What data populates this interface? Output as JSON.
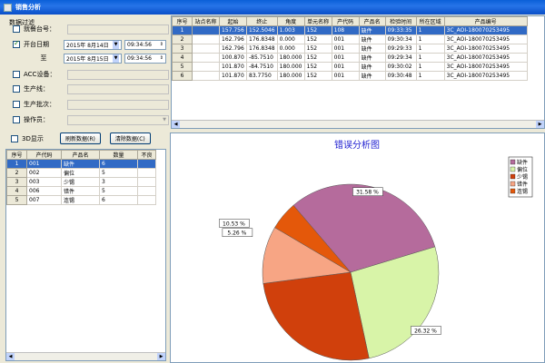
{
  "window": {
    "title": "销售分析"
  },
  "filter": {
    "section": "数据过滤",
    "rows": [
      {
        "label": "就餐台号：",
        "checked": false
      },
      {
        "label": "开台日期",
        "checked": true,
        "date": "2015年 8月14日",
        "time": "09:34:56"
      },
      {
        "label": "至",
        "date": "2015年 8月15日",
        "time": "09:34:56"
      },
      {
        "label": "ACC设备：",
        "checked": false
      },
      {
        "label": "生产线：",
        "checked": false
      },
      {
        "label": "生产批次：",
        "checked": false
      },
      {
        "label": "操作员：",
        "checked": false
      }
    ]
  },
  "actions": {
    "display_label": "3D显示",
    "refresh_label": "刷新数据(R)",
    "clear_label": "清除数据(C)"
  },
  "detail_table": {
    "columns": [
      "序号",
      "站点名称",
      "起始",
      "终止",
      "角度",
      "单元名称",
      "产代码",
      "产品名",
      "检验时间",
      "所在区域",
      "产品编号"
    ],
    "rows": [
      [
        "1",
        "",
        "157.756",
        "152.5046",
        "1.003",
        "152",
        "108",
        "缺件",
        "09:33:35",
        "1",
        "3C_AOI-180070253495"
      ],
      [
        "2",
        "",
        "162.796",
        "176.8348",
        "0.000",
        "152",
        "001",
        "缺件",
        "09:30:34",
        "1",
        "3C_AOI-180070253495"
      ],
      [
        "3",
        "",
        "162.796",
        "176.8348",
        "0.000",
        "152",
        "001",
        "缺件",
        "09:29:33",
        "1",
        "3C_AOI-180070253495"
      ],
      [
        "4",
        "",
        "100.870",
        "-85.7510",
        "180.000",
        "152",
        "001",
        "缺件",
        "09:29:34",
        "1",
        "3C_AOI-180070253495"
      ],
      [
        "5",
        "",
        "101.870",
        "-84.7510",
        "180.000",
        "152",
        "001",
        "缺件",
        "09:30:02",
        "1",
        "3C_AOI-180070253495"
      ],
      [
        "6",
        "",
        "101.870",
        "83.7750",
        "180.000",
        "152",
        "001",
        "缺件",
        "09:30:48",
        "1",
        "3C_AOI-180070253495"
      ]
    ]
  },
  "summary_table": {
    "columns": [
      "序号",
      "产代码",
      "产品名",
      "数量",
      "不良"
    ],
    "rows": [
      [
        "1",
        "001",
        "缺件",
        "6",
        ""
      ],
      [
        "2",
        "002",
        "偏位",
        "5",
        ""
      ],
      [
        "3",
        "003",
        "少锡",
        "3",
        ""
      ],
      [
        "4",
        "006",
        "错件",
        "5",
        ""
      ],
      [
        "5",
        "007",
        "连锡",
        "6",
        ""
      ]
    ]
  },
  "chart_data": {
    "type": "pie",
    "title": "错误分析图",
    "series": [
      {
        "name": "缺件",
        "value": 31.58,
        "label": "31.58 %",
        "color": "#b56b9c"
      },
      {
        "name": "偏位",
        "value": 26.32,
        "label": "26.32 %",
        "color": "#d8f4a8"
      },
      {
        "name": "少锡",
        "value": 26.32,
        "label": "26.32 %",
        "color": "#d0400c"
      },
      {
        "name": "错件",
        "value": 10.53,
        "label": "10.53 %",
        "color": "#f7a584"
      },
      {
        "name": "连锡",
        "value": 5.26,
        "label": "5.26 %",
        "color": "#e4580a"
      }
    ],
    "legend_position": "top-right"
  }
}
